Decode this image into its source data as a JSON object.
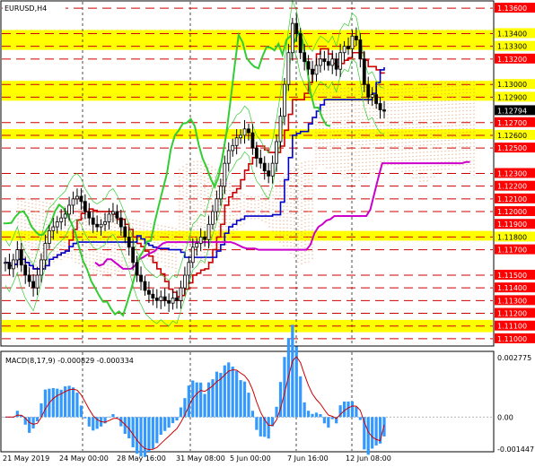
{
  "window": {
    "symbol_label": "EURUSD,H4"
  },
  "price_axis": {
    "labels": [
      "1.13600",
      "1.13400",
      "1.13300",
      "1.13200",
      "1.13000",
      "1.12900",
      "1.12794",
      "1.12700",
      "1.12600",
      "1.12500",
      "1.12300",
      "1.12200",
      "1.12100",
      "1.12000",
      "1.11900",
      "1.11800",
      "1.11700",
      "1.11500",
      "1.11400",
      "1.11300",
      "1.11200",
      "1.11100",
      "1.11000"
    ],
    "current_price": "1.12794",
    "highlight_colors": {
      "yellow": "#ffff00",
      "black": "#000000",
      "red": "#ff0000"
    }
  },
  "macd": {
    "label": "MACD(8,17,9) -0.000829 -0.000334",
    "axis_labels": [
      "0.002775",
      "0.00",
      "-0.001447"
    ]
  },
  "time_axis": {
    "labels": [
      "21 May 2019",
      "24 May 00:00",
      "28 May 16:00",
      "31 May 08:00",
      "5 Jun 00:00",
      "7 Jun 16:00",
      "12 Jun 08:00"
    ]
  },
  "colors": {
    "zone_yellow": "#ffff00",
    "level_red": "#cc0000",
    "candle": "#000000",
    "kijun_red": "#cc0000",
    "tenkan_blue": "#0000cc",
    "chikou_green": "#33cc33",
    "senkou_magenta": "#cc00cc",
    "cloud_fill": "#e8a070",
    "macd_bar": "#3399ff",
    "macd_signal": "#cc0000"
  },
  "chart_data": {
    "type": "candlestick",
    "title": "EURUSD,H4",
    "ylim": [
      1.1095,
      1.1365
    ],
    "price_levels": [
      1.136,
      1.134,
      1.133,
      1.132,
      1.13,
      1.129,
      1.127,
      1.126,
      1.125,
      1.123,
      1.122,
      1.121,
      1.12,
      1.118,
      1.117,
      1.115,
      1.114,
      1.113,
      1.112,
      1.111,
      1.11
    ],
    "support_resistance_zones": [
      [
        1.133,
        1.134
      ],
      [
        1.129,
        1.13
      ],
      [
        1.126,
        1.1262
      ],
      [
        1.118,
        1.1182
      ],
      [
        1.1108,
        1.1112
      ]
    ],
    "current_price": 1.12794,
    "close_series": [
      1.116,
      1.1155,
      1.1162,
      1.117,
      1.1158,
      1.115,
      1.1145,
      1.114,
      1.115,
      1.1162,
      1.1175,
      1.1185,
      1.1188,
      1.1192,
      1.1195,
      1.1198,
      1.1205,
      1.121,
      1.1212,
      1.1208,
      1.12,
      1.1195,
      1.119,
      1.1188,
      1.119,
      1.1192,
      1.1198,
      1.12,
      1.1195,
      1.1188,
      1.118,
      1.1172,
      1.116,
      1.115,
      1.1145,
      1.1138,
      1.1135,
      1.1132,
      1.113,
      1.1133,
      1.113,
      1.1128,
      1.1132,
      1.113,
      1.114,
      1.115,
      1.116,
      1.1172,
      1.1175,
      1.118,
      1.1178,
      1.119,
      1.12,
      1.121,
      1.122,
      1.1238,
      1.1248,
      1.1252,
      1.1258,
      1.126,
      1.1265,
      1.1262,
      1.125,
      1.1242,
      1.1238,
      1.1232,
      1.1228,
      1.1238,
      1.1255,
      1.1275,
      1.13,
      1.1325,
      1.1348,
      1.134,
      1.1325,
      1.1318,
      1.1312,
      1.1308,
      1.1315,
      1.132,
      1.1318,
      1.1315,
      1.132,
      1.1312,
      1.1325,
      1.133,
      1.1328,
      1.1338,
      1.1335,
      1.132,
      1.13,
      1.129,
      1.1292,
      1.1285,
      1.128,
      1.1279
    ],
    "macd": {
      "label": "MACD(8,17,9)",
      "main": -0.000829,
      "signal": -0.000334,
      "ylim": [
        -0.001447,
        0.002775
      ]
    },
    "x_tick_labels": [
      "21 May 2019",
      "24 May 00:00",
      "28 May 16:00",
      "31 May 08:00",
      "5 Jun 00:00",
      "7 Jun 16:00",
      "12 Jun 08:00"
    ]
  }
}
